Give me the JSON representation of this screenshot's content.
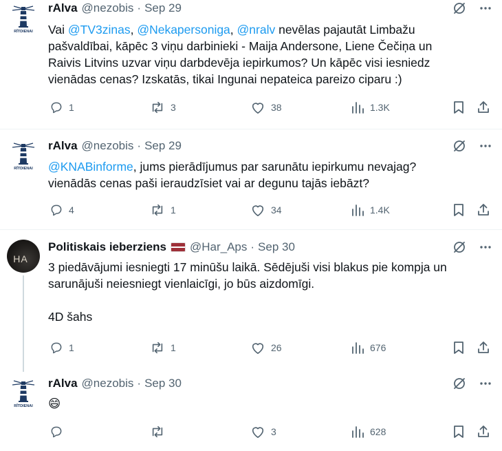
{
  "tweets": [
    {
      "author": {
        "name": "rAlva",
        "handle": "@nezobis",
        "date": "Sep 29",
        "avatar": "lighthouse-avatar",
        "avatar_caption": "RĪTDIENAI"
      },
      "text_parts": [
        {
          "t": "Vai ",
          "mention": false
        },
        {
          "t": "@TV3zinas",
          "mention": true
        },
        {
          "t": ", ",
          "mention": false
        },
        {
          "t": "@Nekapersoniga",
          "mention": true
        },
        {
          "t": ", ",
          "mention": false
        },
        {
          "t": "@nralv",
          "mention": true
        },
        {
          "t": " nevēlas pajautāt Limbažu\npašvaldībai, kāpēc 3 viņu darbinieki - Maija Andersone, Liene Čečiņa un\nRaivis Litvins uzvar viņu darbdevēja iepirkumos? Un kāpēc visi iesniedz\nvienādas cenas? Izskatās, tikai Ingunai nepateica pareizo ciparu :)",
          "mention": false
        }
      ],
      "stats": {
        "replies": "1",
        "reposts": "3",
        "likes": "38",
        "views": "1.3K"
      }
    },
    {
      "author": {
        "name": "rAlva",
        "handle": "@nezobis",
        "date": "Sep 29",
        "avatar": "lighthouse-avatar",
        "avatar_caption": "RĪTDIENAI"
      },
      "text_parts": [
        {
          "t": "@KNABinforme",
          "mention": true
        },
        {
          "t": ", jums pierādījumus par sarunātu iepirkumu nevajag?\nvienādās cenas paši ieraudzīsiet vai ar degunu tajās iebāzt?",
          "mention": false
        }
      ],
      "stats": {
        "replies": "4",
        "reposts": "1",
        "likes": "34",
        "views": "1.4K"
      }
    },
    {
      "author": {
        "name": "Politiskais ieberziens",
        "handle": "@Har_Aps",
        "date": "Sep 30",
        "avatar": "dark-avatar",
        "avatar_caption": "HA",
        "flag": "latvia-flag"
      },
      "text_parts": [
        {
          "t": "3 piedāvājumi iesniegti 17 minūšu laikā. Sēdējuši visi blakus pie kompja un\nsarunājuši neiesniegt vienlaicīgi, jo būs aizdomīgi.\n\n4D šahs",
          "mention": false
        }
      ],
      "stats": {
        "replies": "1",
        "reposts": "1",
        "likes": "26",
        "views": "676"
      }
    },
    {
      "author": {
        "name": "rAlva",
        "handle": "@nezobis",
        "date": "Sep 30",
        "avatar": "lighthouse-avatar",
        "avatar_caption": "RĪTDIENAI"
      },
      "text_parts": [
        {
          "t": "😄",
          "mention": false
        }
      ],
      "stats": {
        "replies": "",
        "reposts": "",
        "likes": "3",
        "views": "628"
      }
    }
  ],
  "colors": {
    "text": "#0f1419",
    "secondary": "#536471",
    "link": "#1d9bf0",
    "divider": "#eff3f4",
    "thread": "#cfd9de"
  },
  "icons": [
    "grok-slash-icon",
    "more-icon",
    "reply-icon",
    "repost-icon",
    "like-icon",
    "views-icon",
    "bookmark-icon",
    "share-icon"
  ]
}
